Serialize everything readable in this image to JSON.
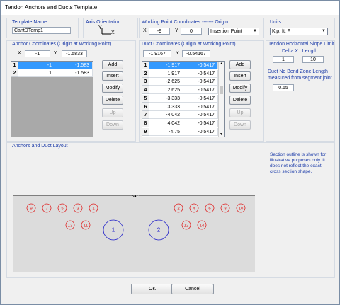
{
  "window": {
    "title": "Tendon Anchors and Ducts Template"
  },
  "template": {
    "label": "Template Name",
    "value": "CantDTemp1"
  },
  "axis": {
    "label": "Axis Orientation",
    "y": "Y",
    "x": "X"
  },
  "working_point": {
    "label": "Working Point Coordinates ------- Origin",
    "x_label": "X",
    "x_value": "-9",
    "y_label": "Y",
    "y_value": "0",
    "origin_value": "Insertion Point"
  },
  "units": {
    "label": "Units",
    "value": "Kip, ft, F"
  },
  "slope": {
    "label": "Tendon Horizontal Slope Limit",
    "delta_label": "Delta X : Length",
    "delta_value": "1",
    "length_value": "10"
  },
  "bend": {
    "label": "Duct No Bend Zone Length measured from segment joint",
    "value": "0.65"
  },
  "anchor": {
    "label": "Anchor Coordinates (Origin at Working Point)",
    "x_label": "X",
    "x_value": "-1",
    "y_label": "Y",
    "y_value": "-1.5833",
    "rows": [
      [
        "1",
        "-1",
        "-1.583"
      ],
      [
        "2",
        "1",
        "-1.583"
      ]
    ],
    "buttons": {
      "add": "Add",
      "insert": "Insert",
      "modify": "Modify",
      "delete": "Delete",
      "up": "Up",
      "down": "Down"
    }
  },
  "duct": {
    "label": "Duct Coordinates (Origin at Working Point)",
    "x_value": "-1.9167",
    "y_label": "Y",
    "y_value": "-0.54167",
    "rows": [
      [
        "1",
        "-1.917",
        "-0.5417"
      ],
      [
        "2",
        "1.917",
        "-0.5417"
      ],
      [
        "3",
        "-2.625",
        "-0.5417"
      ],
      [
        "4",
        "2.625",
        "-0.5417"
      ],
      [
        "5",
        "-3.333",
        "-0.5417"
      ],
      [
        "6",
        "3.333",
        "-0.5417"
      ],
      [
        "7",
        "-4.042",
        "-0.5417"
      ],
      [
        "8",
        "4.042",
        "-0.5417"
      ],
      [
        "9",
        "-4.75",
        "-0.5417"
      ]
    ],
    "buttons": {
      "add": "Add",
      "insert": "Insert",
      "modify": "Modify",
      "delete": "Delete",
      "up": "Up",
      "down": "Down"
    }
  },
  "layout": {
    "label": "Anchors and Duct Layout",
    "note": "Section outline is shown for illustrative purposes only. It does not reflect the exact cross section shape.",
    "wp_label": "WP",
    "ducts_top": [
      "9",
      "7",
      "5",
      "3",
      "1",
      "2",
      "4",
      "6",
      "8",
      "10"
    ],
    "ducts_bottom": [
      "13",
      "11",
      "12",
      "14"
    ],
    "anchors": [
      "1",
      "2"
    ],
    "duct_color": "#e02020",
    "anchor_color": "#2020c8"
  },
  "footer": {
    "ok": "OK",
    "cancel": "Cancel"
  }
}
